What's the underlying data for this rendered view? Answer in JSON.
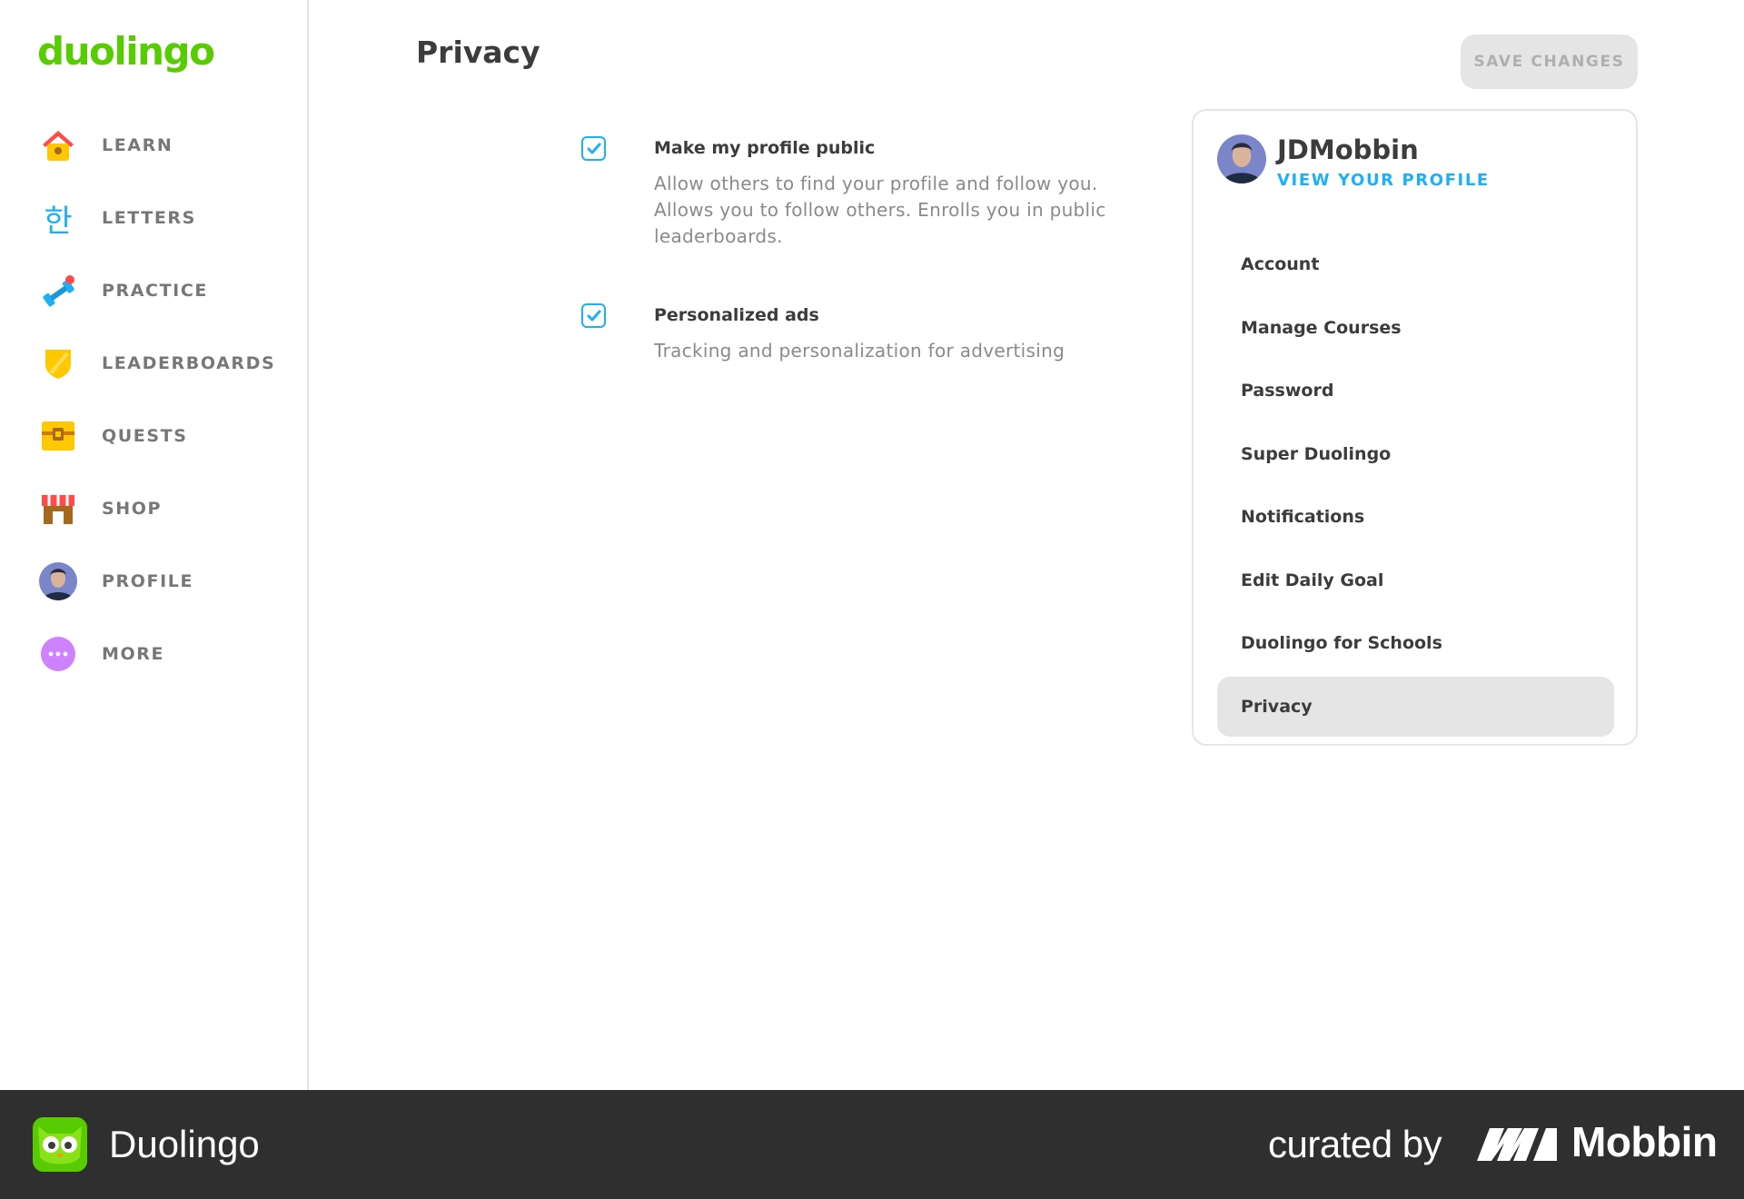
{
  "brand": {
    "logo_text": "duolingo",
    "accent": "#58cc02",
    "link_color": "#1cb0f6"
  },
  "sidebar": {
    "items": [
      {
        "label": "LEARN",
        "icon": "house-icon"
      },
      {
        "label": "LETTERS",
        "icon": "hangul-letter-icon"
      },
      {
        "label": "PRACTICE",
        "icon": "dumbbell-icon"
      },
      {
        "label": "LEADERBOARDS",
        "icon": "shield-icon"
      },
      {
        "label": "QUESTS",
        "icon": "treasure-chest-icon"
      },
      {
        "label": "SHOP",
        "icon": "shop-icon"
      },
      {
        "label": "PROFILE",
        "icon": "avatar-icon"
      },
      {
        "label": "MORE",
        "icon": "more-dots-icon"
      }
    ]
  },
  "main": {
    "title": "Privacy",
    "save_label": "SAVE CHANGES",
    "settings": [
      {
        "title": "Make my profile public",
        "description": "Allow others to find your profile and follow you. Allows you to follow others. Enrolls you in public leaderboards.",
        "checked": true
      },
      {
        "title": "Personalized ads",
        "description": "Tracking and personalization for advertising",
        "checked": true
      }
    ]
  },
  "panel": {
    "username": "JDMobbin",
    "view_profile": "VIEW YOUR PROFILE",
    "menu": [
      {
        "label": "Account",
        "active": false
      },
      {
        "label": "Manage Courses",
        "active": false
      },
      {
        "label": "Password",
        "active": false
      },
      {
        "label": "Super Duolingo",
        "active": false
      },
      {
        "label": "Notifications",
        "active": false
      },
      {
        "label": "Edit Daily Goal",
        "active": false
      },
      {
        "label": "Duolingo for Schools",
        "active": false
      },
      {
        "label": "Privacy",
        "active": true
      }
    ]
  },
  "footer": {
    "app_name": "Duolingo",
    "curated_by": "curated by",
    "mobbin": "Mobbin"
  }
}
